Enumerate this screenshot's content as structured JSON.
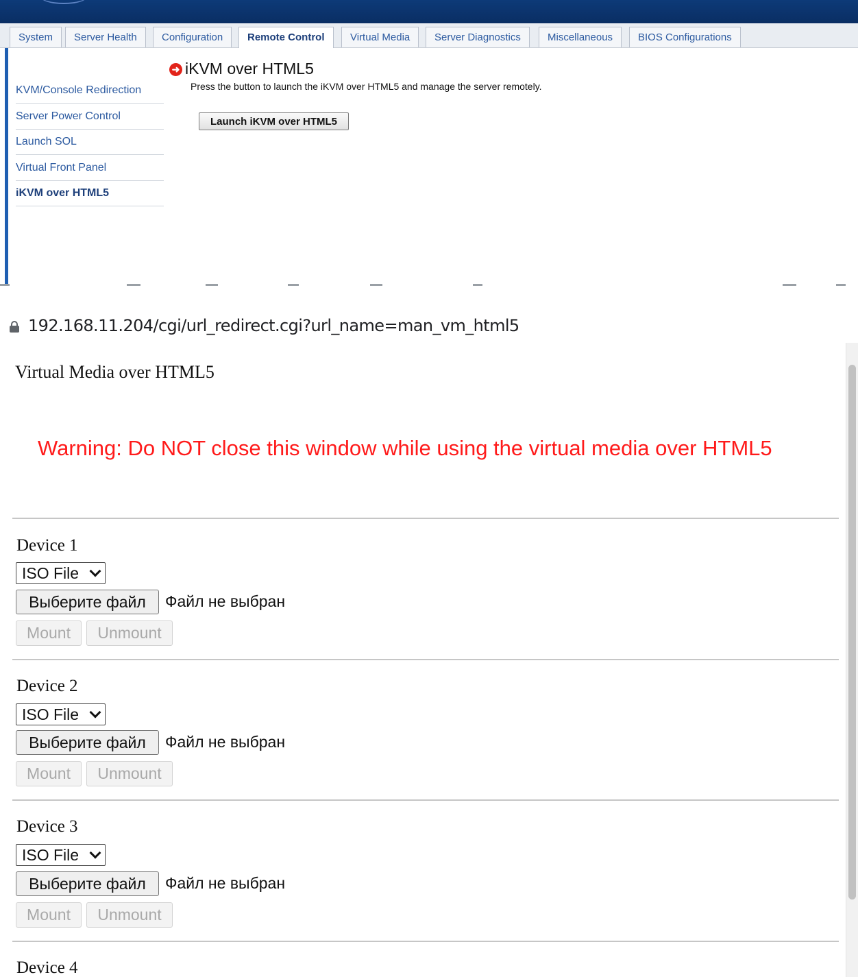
{
  "bmc": {
    "tabs": [
      "System",
      "Server Health",
      "Configuration",
      "Remote Control",
      "Virtual Media",
      "Server Diagnostics",
      "Miscellaneous",
      "BIOS Configurations"
    ],
    "active_tab": "Remote Control",
    "sidebar": [
      "KVM/Console Redirection",
      "Server Power Control",
      "Launch SOL",
      "Virtual Front Panel",
      "iKVM over HTML5"
    ],
    "active_sidebar": "iKVM over HTML5",
    "section_title": "iKVM over HTML5",
    "description": "Press the button to launch the iKVM over HTML5 and manage the server remotely.",
    "launch_button": "Launch iKVM over HTML5",
    "colors": {
      "header": "#0a2e63",
      "link": "#2c5aa0",
      "accent_rule": "#1f5fb2",
      "arrow": "#e2231a"
    }
  },
  "browser": {
    "url": "192.168.11.204/cgi/url_redirect.cgi?url_name=man_vm_html5",
    "icons": [
      "lock-icon"
    ]
  },
  "virtual_media": {
    "title": "Virtual Media over HTML5",
    "warning": "Warning: Do NOT close this window while using the virtual media over HTML5",
    "warning_color": "#ff1a1a",
    "devices": [
      {
        "label": "Device 1",
        "type": "ISO File",
        "choose_button": "Выберите файл",
        "file_status": "Файл не выбран",
        "mount": "Mount",
        "unmount": "Unmount"
      },
      {
        "label": "Device 2",
        "type": "ISO File",
        "choose_button": "Выберите файл",
        "file_status": "Файл не выбран",
        "mount": "Mount",
        "unmount": "Unmount"
      },
      {
        "label": "Device 3",
        "type": "ISO File",
        "choose_button": "Выберите файл",
        "file_status": "Файл не выбран",
        "mount": "Mount",
        "unmount": "Unmount"
      },
      {
        "label": "Device 4"
      }
    ]
  }
}
